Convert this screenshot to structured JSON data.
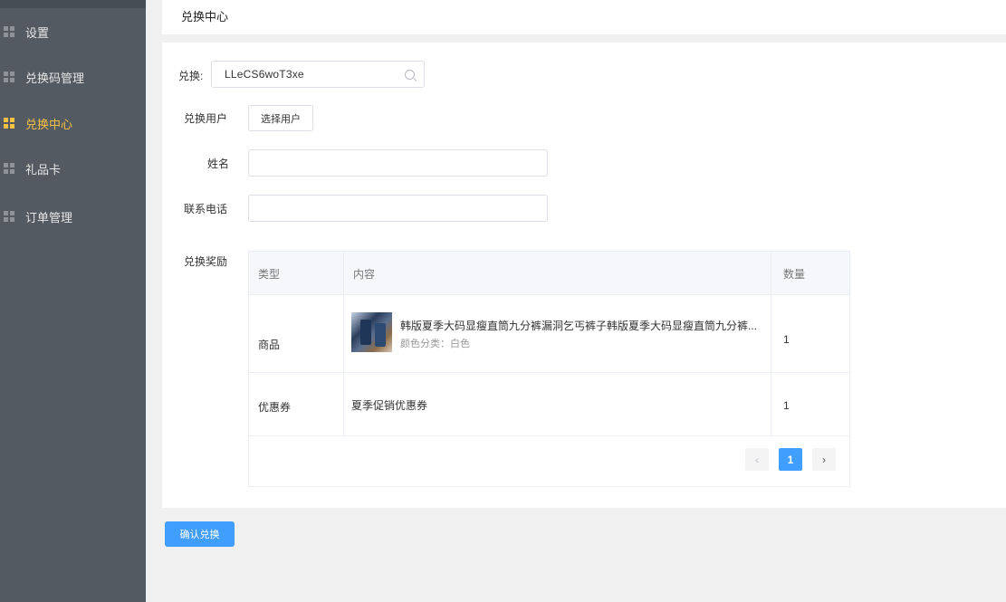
{
  "sidebar": {
    "items": [
      {
        "label": "设置",
        "icon": "grid-icon",
        "active": false
      },
      {
        "label": "兑换码管理",
        "icon": "grid-icon",
        "active": false
      },
      {
        "label": "兑换中心",
        "icon": "grid-icon",
        "active": true
      },
      {
        "label": "礼品卡",
        "icon": "grid-icon",
        "active": false
      },
      {
        "label": "订单管理",
        "icon": "grid-icon",
        "active": false
      }
    ]
  },
  "header": {
    "title": "兑换中心"
  },
  "form": {
    "redeem_label": "兑换:",
    "redeem_value": "LLeCS6woT3xe",
    "user_label": "兑换用户",
    "select_user_button": "选择用户",
    "name_label": "姓名",
    "name_value": "",
    "phone_label": "联系电话",
    "phone_value": "",
    "rewards_label": "兑换奖励"
  },
  "table": {
    "columns": [
      "类型",
      "内容",
      "数量"
    ],
    "rows": [
      {
        "type": "商品",
        "content": "韩版夏季大码显瘦直筒九分裤漏洞乞丐裤子韩版夏季大码显瘦直筒九分裤...",
        "spec": "颜色分类：白色",
        "qty": "1"
      },
      {
        "type": "优惠券",
        "content": "夏季促销优惠券",
        "spec": "",
        "qty": "1"
      }
    ]
  },
  "pagination": {
    "prev": "‹",
    "current": "1",
    "next": "›"
  },
  "actions": {
    "confirm": "确认兑换"
  },
  "colors": {
    "sidebar_bg": "#545a61",
    "active": "#f5c242",
    "primary": "#409eff"
  }
}
